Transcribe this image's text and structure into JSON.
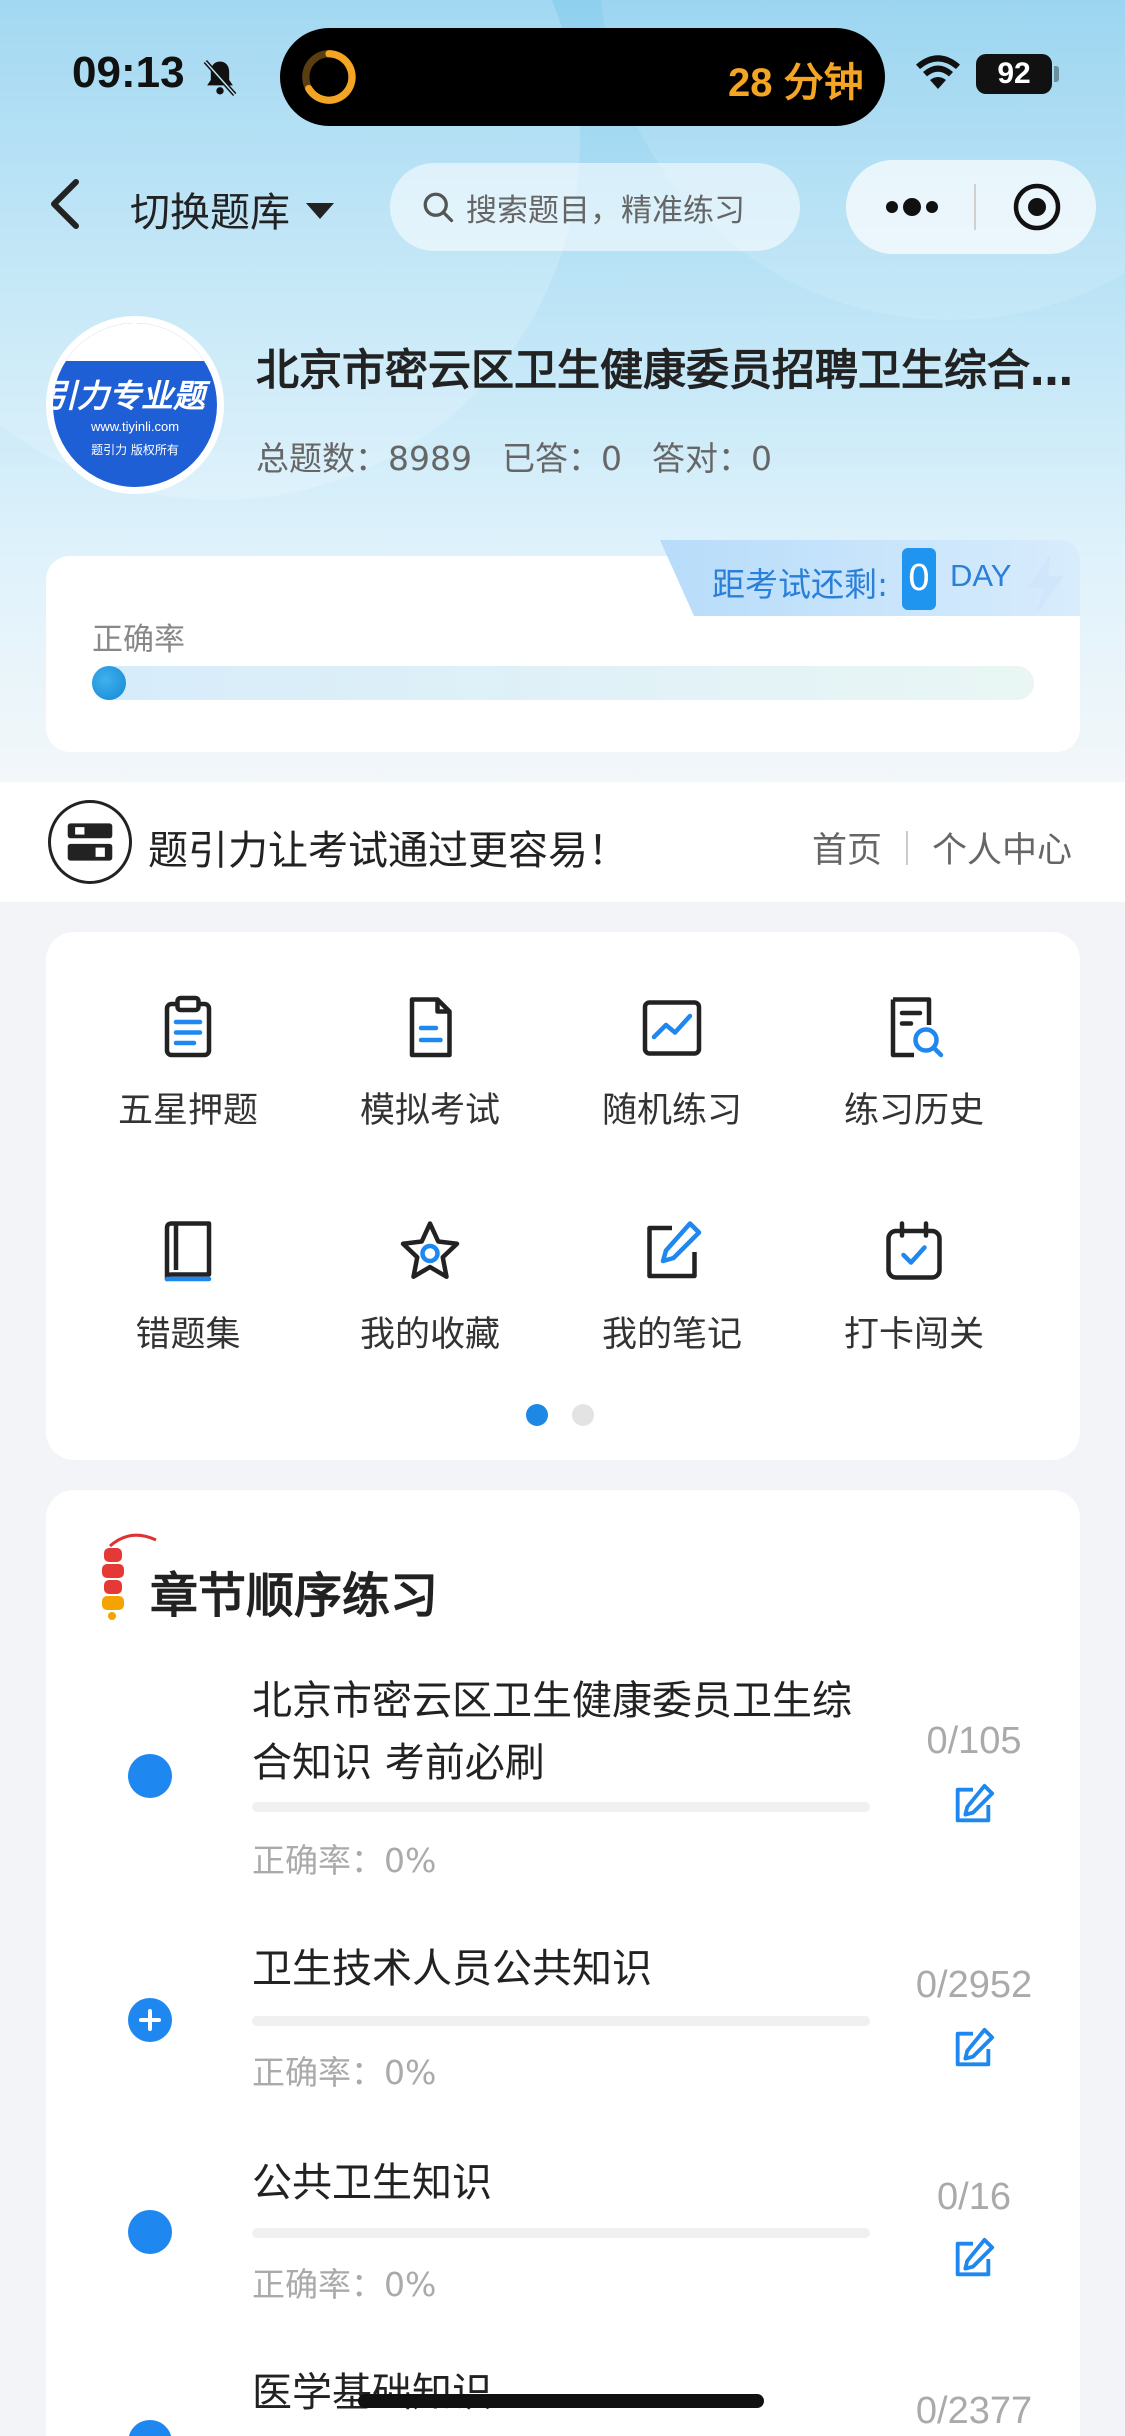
{
  "status_bar": {
    "time": "09:13",
    "timer_text": "28 分钟",
    "battery": "92"
  },
  "nav": {
    "switch_label": "切换题库",
    "search_placeholder": "搜索题目，精准练习"
  },
  "bank": {
    "logo_brand": "引力专业题",
    "logo_url": "www.tiyinli.com",
    "logo_copyright": "题引力 版权所有",
    "title": "北京市密云区卫生健康委员招聘卫生综合知识",
    "stats": {
      "total": "总题数：8989",
      "answered": "已答：0",
      "correct": "答对：0"
    }
  },
  "accuracy_card": {
    "exam_label": "距考试还剩:",
    "days": "0",
    "day_unit": "DAY",
    "accuracy_label": "正确率",
    "accuracy_value": 0
  },
  "slogan": {
    "text": "题引力让考试通过更容易！",
    "links": [
      "首页",
      "个人中心"
    ]
  },
  "grid": {
    "items": [
      {
        "label": "五星押题",
        "icon": "clipboard-icon"
      },
      {
        "label": "模拟考试",
        "icon": "document-icon"
      },
      {
        "label": "随机练习",
        "icon": "chart-icon"
      },
      {
        "label": "练习历史",
        "icon": "search-doc-icon"
      },
      {
        "label": "错题集",
        "icon": "book-icon"
      },
      {
        "label": "我的收藏",
        "icon": "star-icon"
      },
      {
        "label": "我的笔记",
        "icon": "note-icon"
      },
      {
        "label": "打卡闯关",
        "icon": "calendar-check-icon"
      }
    ],
    "page_count": 2,
    "active_page": 1
  },
  "chapters": {
    "title": "章节顺序练习",
    "items": [
      {
        "name": "北京市密云区卫生健康委员卫生综合知识 考前必刷",
        "accuracy": "正确率：0%",
        "count": "0/105"
      },
      {
        "name": "卫生技术人员公共知识",
        "accuracy": "正确率：0%",
        "count": "0/2952"
      },
      {
        "name": "公共卫生知识",
        "accuracy": "正确率：0%",
        "count": "0/16"
      },
      {
        "name": "医学基础知识",
        "accuracy": "",
        "count": "0/2377"
      }
    ]
  },
  "colors": {
    "accent": "#1e88f0",
    "timer": "#f5a524"
  }
}
